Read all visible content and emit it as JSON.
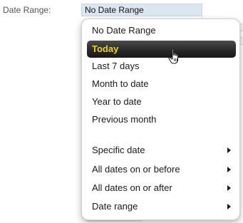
{
  "form": {
    "date_range_label": "Date Range:",
    "date_range_value": "No Date Range"
  },
  "menu": {
    "items": [
      {
        "label": "No Date Range"
      },
      {
        "label": "Today",
        "selected": true
      },
      {
        "label": "Last 7 days"
      },
      {
        "label": "Month to date"
      },
      {
        "label": "Year to date"
      },
      {
        "label": "Previous month"
      },
      {
        "label": "Specific date",
        "submenu": true
      },
      {
        "label": "All dates on or before",
        "submenu": true
      },
      {
        "label": "All dates on or after",
        "submenu": true
      },
      {
        "label": "Date range",
        "submenu": true
      }
    ]
  },
  "colors": {
    "highlight_text": "#f4d21a",
    "highlight_bg": "#2a2a2a"
  },
  "icons": {
    "cursor": "hand-pointer-icon",
    "submenu": "arrow-right-icon"
  }
}
